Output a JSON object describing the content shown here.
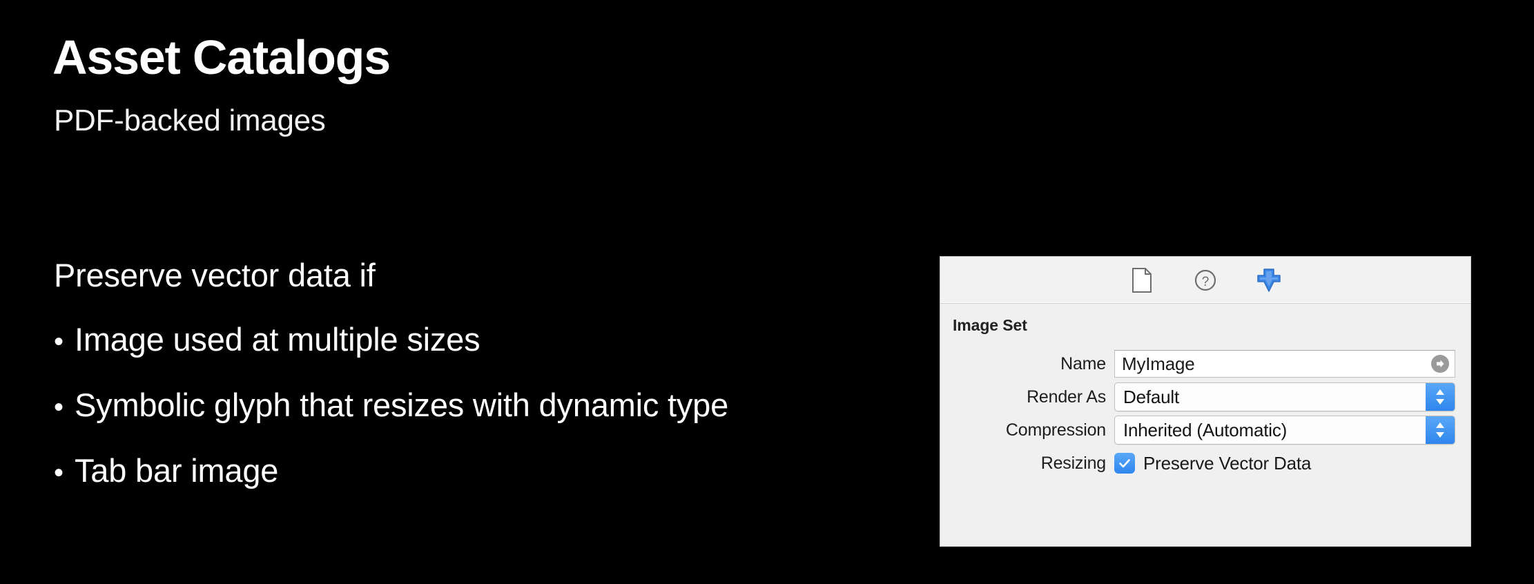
{
  "slide": {
    "title": "Asset Catalogs",
    "subtitle": "PDF-backed images",
    "lead": "Preserve vector data if",
    "bullet_marker": "•",
    "bullets": [
      "Image used at multiple sizes",
      "Symbolic glyph that resizes with dynamic type",
      "Tab bar image"
    ],
    "background_color": "#000000",
    "text_color": "#ffffff"
  },
  "inspector": {
    "toolbar": {
      "icons": [
        {
          "name": "file-inspector-icon",
          "label": "File Inspector",
          "selected": false
        },
        {
          "name": "quick-help-icon",
          "label": "Quick Help",
          "selected": false
        },
        {
          "name": "attributes-inspector-icon",
          "label": "Attributes Inspector",
          "selected": true
        }
      ],
      "selected_color": "#3b87e8"
    },
    "section_title": "Image Set",
    "rows": [
      {
        "label": "Name",
        "control": "text-field",
        "value": "MyImage",
        "accessory": "reveal-arrow-button"
      },
      {
        "label": "Render As",
        "control": "popup-button",
        "value": "Default"
      },
      {
        "label": "Compression",
        "control": "popup-button",
        "value": "Inherited (Automatic)"
      },
      {
        "label": "Resizing",
        "control": "checkbox",
        "value": "Preserve Vector Data",
        "checked": true
      }
    ],
    "accent_color": "#2f86ee",
    "background_color": "#f0f0f0"
  }
}
